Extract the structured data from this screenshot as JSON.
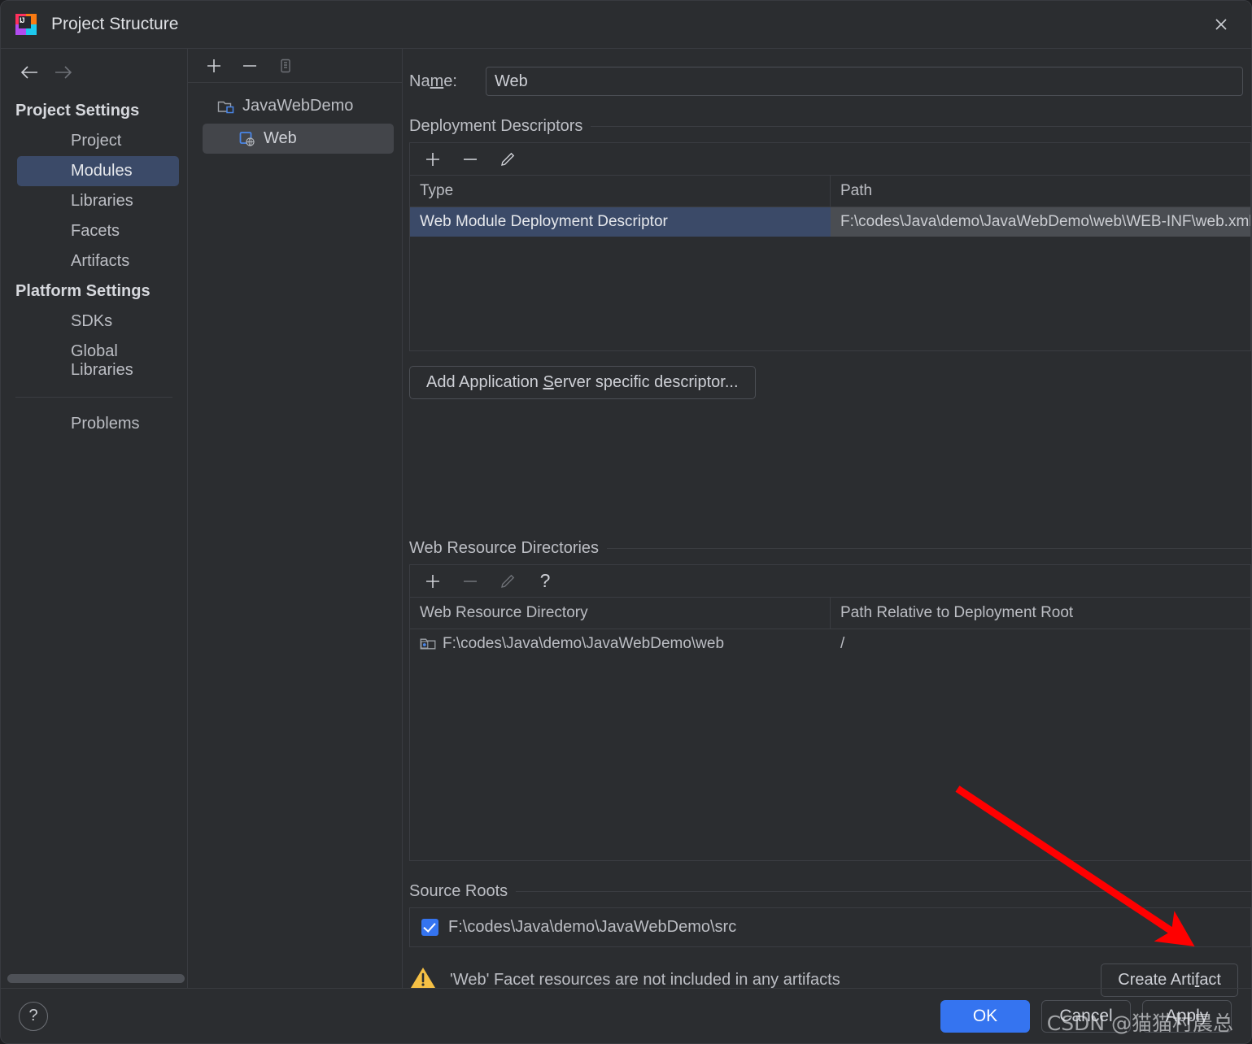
{
  "window": {
    "title": "Project Structure",
    "app_icon": "intellij-idea-icon",
    "close_icon": "close-icon"
  },
  "nav": {
    "back_icon": "arrow-left-icon",
    "forward_icon": "arrow-right-icon",
    "groups": [
      {
        "label": "Project Settings",
        "items": [
          {
            "label": "Project",
            "selected": false
          },
          {
            "label": "Modules",
            "selected": true
          },
          {
            "label": "Libraries",
            "selected": false
          },
          {
            "label": "Facets",
            "selected": false
          },
          {
            "label": "Artifacts",
            "selected": false
          }
        ]
      },
      {
        "label": "Platform Settings",
        "items": [
          {
            "label": "SDKs",
            "selected": false
          },
          {
            "label": "Global Libraries",
            "selected": false
          }
        ]
      }
    ],
    "extra": [
      {
        "label": "Problems"
      }
    ]
  },
  "tree": {
    "toolbar": [
      {
        "name": "add-module-button",
        "glyph": "+"
      },
      {
        "name": "remove-module-button",
        "glyph": "−"
      },
      {
        "name": "copy-module-button",
        "glyph": "copy-icon"
      }
    ],
    "nodes": [
      {
        "label": "JavaWebDemo",
        "icon": "module-group-icon",
        "selected": false,
        "child": false
      },
      {
        "label": "Web",
        "icon": "web-facet-icon",
        "selected": true,
        "child": true
      }
    ]
  },
  "detail": {
    "name_label": "Name:",
    "name_label_mnemonic": "m",
    "name_value": "Web",
    "deployment_descriptors": {
      "title": "Deployment Descriptors",
      "toolbar": [
        {
          "name": "add-descriptor-button",
          "glyph": "+"
        },
        {
          "name": "remove-descriptor-button",
          "glyph": "−"
        },
        {
          "name": "edit-descriptor-button",
          "glyph": "pencil-icon"
        }
      ],
      "columns": [
        "Type",
        "Path"
      ],
      "rows": [
        {
          "type": "Web Module Deployment Descriptor",
          "path": "F:\\codes\\Java\\demo\\JavaWebDemo\\web\\WEB-INF\\web.xml",
          "selected": true
        }
      ]
    },
    "add_app_server_descriptor_button": "Add Application Server specific descriptor...",
    "add_app_server_descriptor_mnemonic": "S",
    "web_resource_directories": {
      "title": "Web Resource Directories",
      "toolbar": [
        {
          "name": "add-web-resource-button",
          "glyph": "+",
          "enabled": true
        },
        {
          "name": "remove-web-resource-button",
          "glyph": "−",
          "enabled": false
        },
        {
          "name": "edit-web-resource-button",
          "glyph": "pencil-icon",
          "enabled": false
        },
        {
          "name": "help-web-resource-button",
          "glyph": "?",
          "enabled": true
        }
      ],
      "columns": [
        "Web Resource Directory",
        "Path Relative to Deployment Root"
      ],
      "rows": [
        {
          "directory": "F:\\codes\\Java\\demo\\JavaWebDemo\\web",
          "relative_path": "/",
          "icon": "folder-icon"
        }
      ]
    },
    "source_roots": {
      "title": "Source Roots",
      "rows": [
        {
          "path": "F:\\codes\\Java\\demo\\JavaWebDemo\\src",
          "checked": true
        }
      ]
    },
    "warning": {
      "icon": "warning-triangle-icon",
      "text": "'Web' Facet resources are not included in any artifacts",
      "action_label": "Create Artifact",
      "action_mnemonic": "f"
    }
  },
  "footer": {
    "help_label": "?",
    "ok_label": "OK",
    "cancel_label": "Cancel",
    "apply_label": "Apply"
  },
  "overlay": {
    "watermark": "CSDN @猫猫村晨总",
    "arrow_color": "#ff0000"
  },
  "colors": {
    "window_bg": "#2b2d30",
    "selection_blue": "#3b4a68",
    "accent_blue": "#3574f0",
    "border": "#393b40",
    "text": "#bcbec4",
    "warning_yellow": "#f5c045"
  }
}
